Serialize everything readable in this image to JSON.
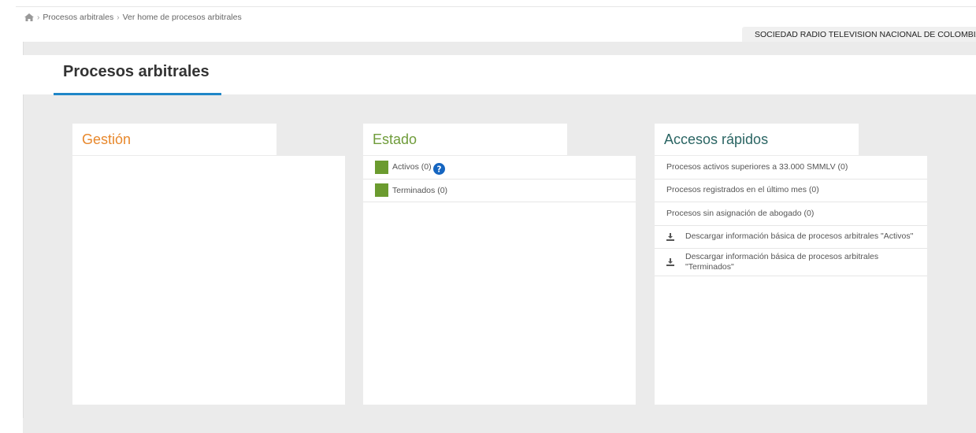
{
  "breadcrumb": {
    "items": [
      "Procesos arbitrales",
      "Ver home de procesos arbitrales"
    ],
    "separator": "›"
  },
  "entity": {
    "name": "SOCIEDAD RADIO TELEVISION NACIONAL DE COLOMBIA"
  },
  "page": {
    "title": "Procesos arbitrales"
  },
  "colors": {
    "accent": "#1f86c8",
    "gestion": "#e8882c",
    "estado": "#6f9c3a",
    "accesos": "#2a6563",
    "swatch": "#6b9b2f",
    "help": "#1565c0"
  },
  "gestion": {
    "title": "Gestión"
  },
  "estado": {
    "title": "Estado",
    "items": [
      {
        "label": "Activos (0)",
        "icon": "help-icon"
      },
      {
        "label": "Terminados (0)"
      }
    ]
  },
  "accesos": {
    "title": "Accesos rápidos",
    "items": [
      {
        "label": "Procesos activos superiores a 33.000 SMMLV (0)"
      },
      {
        "label": "Procesos registrados en el último mes (0)"
      },
      {
        "label": "Procesos sin asignación de abogado (0)"
      },
      {
        "label": "Descargar información básica de procesos arbitrales \"Activos\"",
        "icon": "download-icon"
      },
      {
        "label": "Descargar información básica de procesos arbitrales \"Terminados\"",
        "icon": "download-icon"
      }
    ]
  }
}
